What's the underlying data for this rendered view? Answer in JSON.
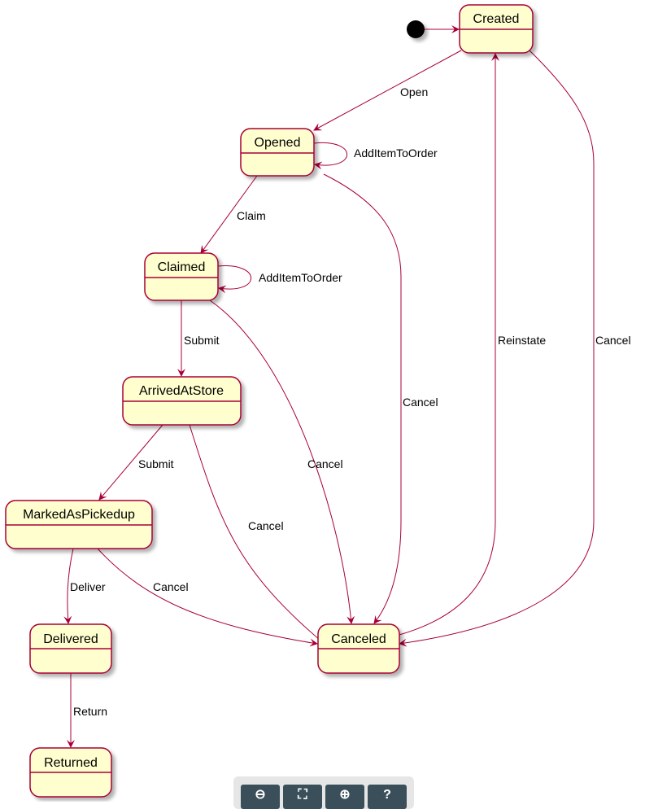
{
  "states": {
    "created": "Created",
    "opened": "Opened",
    "claimed": "Claimed",
    "arrived": "ArrivedAtStore",
    "marked": "MarkedAsPickedup",
    "delivered": "Delivered",
    "returned": "Returned",
    "canceled": "Canceled"
  },
  "transitions": [
    {
      "from": "[*]",
      "to": "Created",
      "label": ""
    },
    {
      "from": "Created",
      "to": "Opened",
      "label": "Open"
    },
    {
      "from": "Opened",
      "to": "Opened",
      "label": "AddItemToOrder"
    },
    {
      "from": "Opened",
      "to": "Claimed",
      "label": "Claim"
    },
    {
      "from": "Claimed",
      "to": "Claimed",
      "label": "AddItemToOrder"
    },
    {
      "from": "Claimed",
      "to": "ArrivedAtStore",
      "label": "Submit"
    },
    {
      "from": "ArrivedAtStore",
      "to": "MarkedAsPickedup",
      "label": "Submit"
    },
    {
      "from": "MarkedAsPickedup",
      "to": "Delivered",
      "label": "Deliver"
    },
    {
      "from": "Delivered",
      "to": "Returned",
      "label": "Return"
    },
    {
      "from": "Opened",
      "to": "Canceled",
      "label": "Cancel"
    },
    {
      "from": "Claimed",
      "to": "Canceled",
      "label": "Cancel"
    },
    {
      "from": "ArrivedAtStore",
      "to": "Canceled",
      "label": "Cancel"
    },
    {
      "from": "MarkedAsPickedup",
      "to": "Canceled",
      "label": "Cancel"
    },
    {
      "from": "Canceled",
      "to": "Created",
      "label": "Reinstate"
    },
    {
      "from": "Created",
      "to": "Canceled",
      "label": "Cancel"
    }
  ],
  "colors": {
    "fill": "#FEFECE",
    "border": "#A80036",
    "toolbar": "#3b4f5a"
  },
  "toolbar": {
    "zoom_out": "zoom-out-icon",
    "fit": "fit-icon",
    "zoom_in": "zoom-in-icon",
    "help": "?"
  }
}
